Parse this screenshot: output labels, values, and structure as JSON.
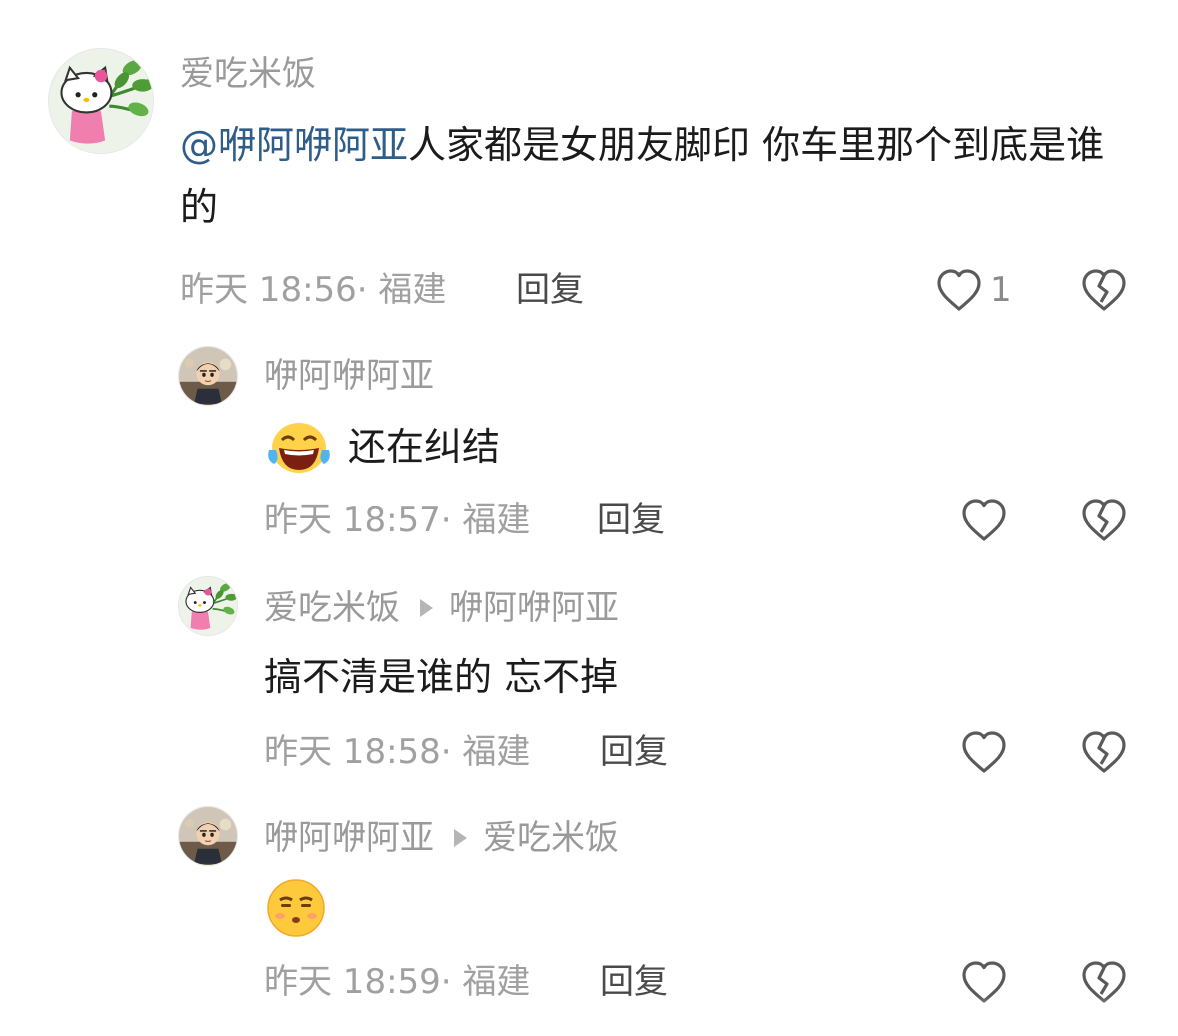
{
  "comments": [
    {
      "user": "爱吃米饭",
      "mention": "@咿阿咿阿亚",
      "text": "人家都是女朋友脚印 你车里那个到底是谁的",
      "time": "昨天 18:56",
      "location": "· 福建",
      "reply_label": "回复",
      "like_count": "1",
      "avatar_icon": "hello-kitty-avatar"
    },
    {
      "user": "咿阿咿阿亚",
      "emoji": "laughing-crying-emoji",
      "text": "还在纠结",
      "time": "昨天 18:57",
      "location": "· 福建",
      "reply_label": "回复",
      "avatar_icon": "cartoon-boy-avatar"
    },
    {
      "user": "爱吃米饭",
      "reply_to": "咿阿咿阿亚",
      "text": "搞不清是谁的 忘不掉",
      "time": "昨天 18:58",
      "location": "· 福建",
      "reply_label": "回复",
      "avatar_icon": "hello-kitty-avatar"
    },
    {
      "user": "咿阿咿阿亚",
      "reply_to": "爱吃米饭",
      "emoji": "unamused-face-emoji",
      "time": "昨天 18:59",
      "location": "· 福建",
      "reply_label": "回复",
      "avatar_icon": "cartoon-boy-avatar"
    }
  ],
  "icons": {
    "like": "heart-outline-icon",
    "dislike": "broken-heart-icon"
  },
  "colors": {
    "mention": "#2f5d8a",
    "meta": "#a0a0a0",
    "text": "#1b1b1b"
  }
}
